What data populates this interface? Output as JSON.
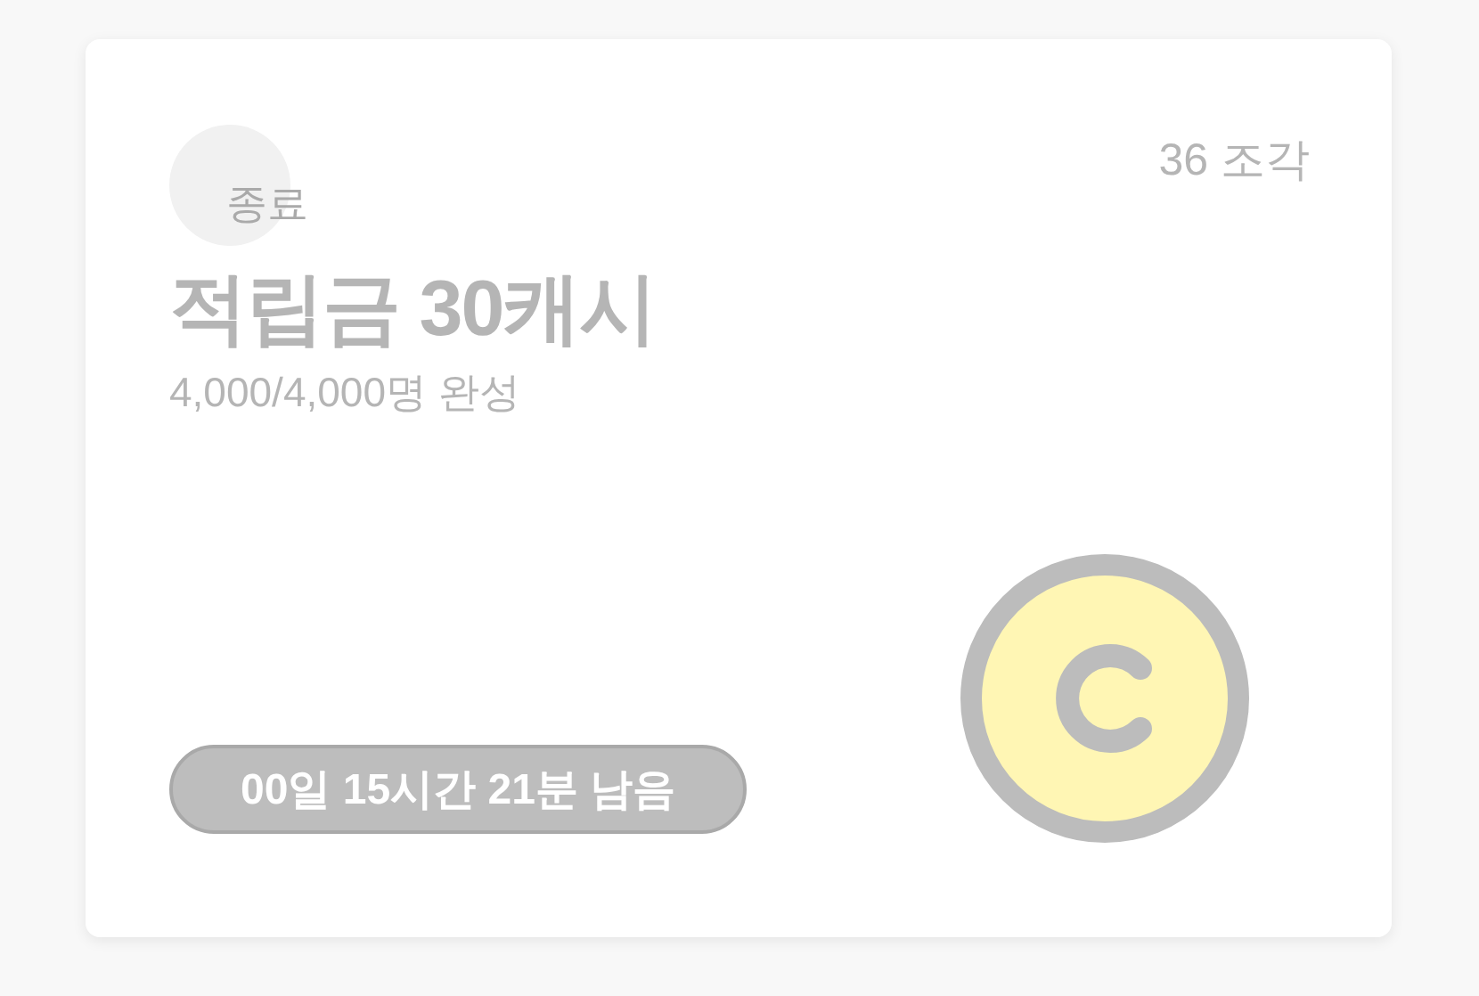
{
  "card": {
    "ended": true,
    "status": "종료",
    "title": "적립금 30캐시",
    "progress_text": "4,000/4,000명 완성",
    "pieces": "36 조각",
    "time_left": "00일 15시간 21분 남음"
  }
}
